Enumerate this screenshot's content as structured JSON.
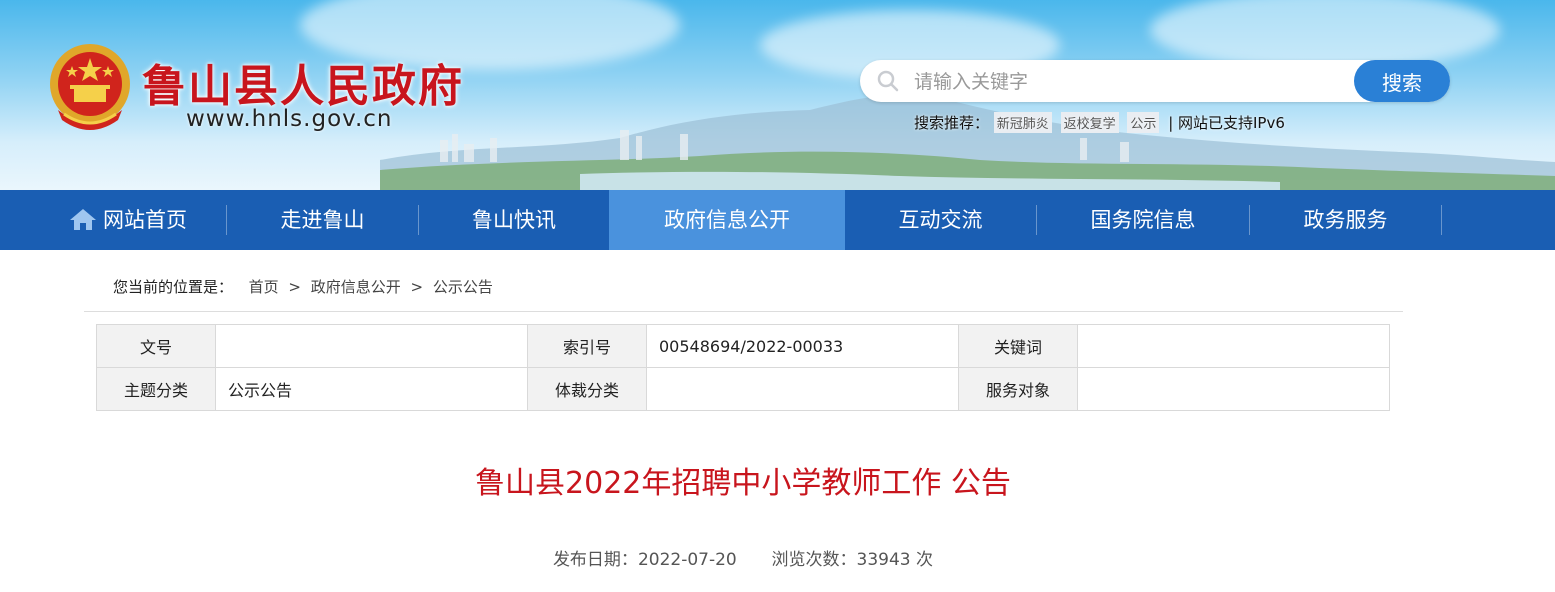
{
  "header": {
    "site_name": "鲁山县人民政府",
    "site_url": "www.hnls.gov.cn",
    "search": {
      "placeholder": "请输入关键字",
      "button_label": "搜索"
    },
    "hot": {
      "label": "搜索推荐：",
      "tags": [
        "新冠肺炎",
        "返校复学",
        "公示"
      ],
      "ipv6_note": "| 网站已支持IPv6"
    }
  },
  "nav": {
    "items": [
      {
        "label": "网站首页",
        "icon": "home-icon"
      },
      {
        "label": "走进鲁山"
      },
      {
        "label": "鲁山快讯"
      },
      {
        "label": "政府信息公开",
        "active": true
      },
      {
        "label": "互动交流"
      },
      {
        "label": "国务院信息"
      },
      {
        "label": "政务服务"
      }
    ]
  },
  "breadcrumb": {
    "prefix": "您当前的位置是：",
    "items": [
      "首页",
      "政府信息公开",
      "公示公告"
    ],
    "separator": ">"
  },
  "meta": {
    "row1": [
      {
        "key": "文号",
        "value": ""
      },
      {
        "key": "索引号",
        "value": "00548694/2022-00033"
      },
      {
        "key": "关键词",
        "value": ""
      }
    ],
    "row2": [
      {
        "key": "主题分类",
        "value": "公示公告"
      },
      {
        "key": "体裁分类",
        "value": ""
      },
      {
        "key": "服务对象",
        "value": ""
      }
    ]
  },
  "article": {
    "title": "鲁山县2022年招聘中小学教师工作 公告",
    "date_label": "发布日期：",
    "date": "2022-07-20",
    "views_label": "浏览次数：",
    "views": "33943",
    "views_unit": "次"
  },
  "colors": {
    "brand_red": "#c8151d",
    "nav_blue": "#1a5eb3",
    "nav_active": "#4a92dd",
    "search_button": "#2a80d6"
  }
}
